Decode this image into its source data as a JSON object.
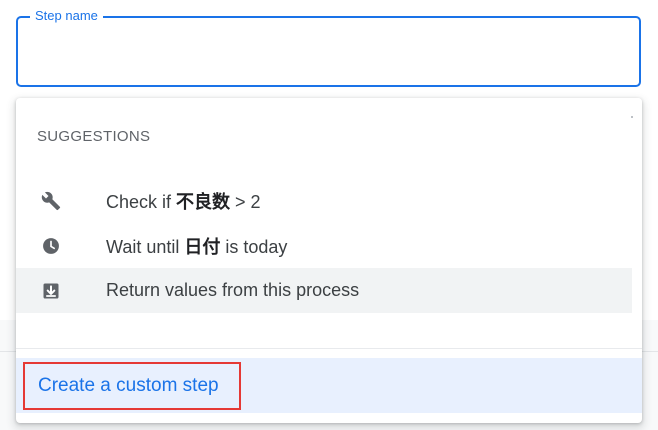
{
  "step_field": {
    "label": "Step name",
    "value": ""
  },
  "suggestions": {
    "header": "SUGGESTIONS",
    "items": [
      {
        "icon": "wrench-icon",
        "prefix": "Check if ",
        "bold": "不良数",
        "suffix": " > 2"
      },
      {
        "icon": "clock-icon",
        "prefix": "Wait until ",
        "bold": "日付",
        "suffix": " is today"
      },
      {
        "icon": "return-arrow-icon",
        "prefix": "Return values from this process",
        "bold": "",
        "suffix": "",
        "highlighted": true
      }
    ]
  },
  "create_custom_step": {
    "label": "Create a custom step"
  },
  "colors": {
    "accent": "#1a73e8",
    "highlight_border": "#e53935",
    "create_bar_bg": "#e8f0fe"
  }
}
